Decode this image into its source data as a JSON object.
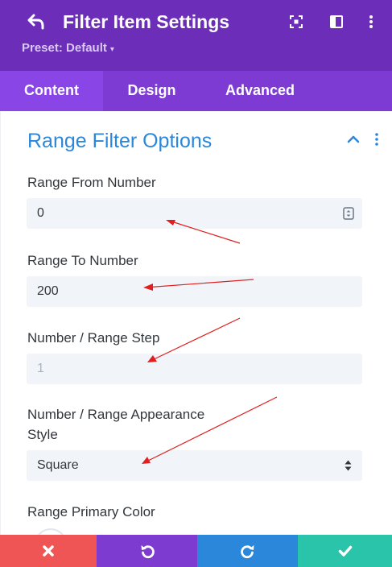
{
  "header": {
    "title": "Filter Item Settings",
    "preset_label": "Preset: Default",
    "preset_caret": "▾",
    "background": "#6c2eb9"
  },
  "tabs": [
    {
      "label": "Content",
      "active": true
    },
    {
      "label": "Design",
      "active": false
    },
    {
      "label": "Advanced",
      "active": false
    }
  ],
  "section": {
    "title": "Range Filter Options"
  },
  "fields": {
    "range_from": {
      "label": "Range From Number",
      "value": "0"
    },
    "range_to": {
      "label": "Range To Number",
      "value": "200"
    },
    "range_step": {
      "label": "Number / Range Step",
      "placeholder": "1"
    },
    "appearance": {
      "label_line1": "Number / Range Appearance",
      "label_line2": "Style",
      "value": "Square"
    },
    "primary_color": {
      "label": "Range Primary Color"
    }
  },
  "footer": {
    "cancel_color": "#ef5555",
    "undo_color": "#7e3bd0",
    "redo_color": "#2b87da",
    "save_color": "#29c4a9"
  },
  "icons": {
    "back": "back-arrow-icon",
    "focus": "focus-mode-icon",
    "split": "split-view-icon",
    "menu": "kebab-menu-icon",
    "collapse": "chevron-up-icon"
  }
}
